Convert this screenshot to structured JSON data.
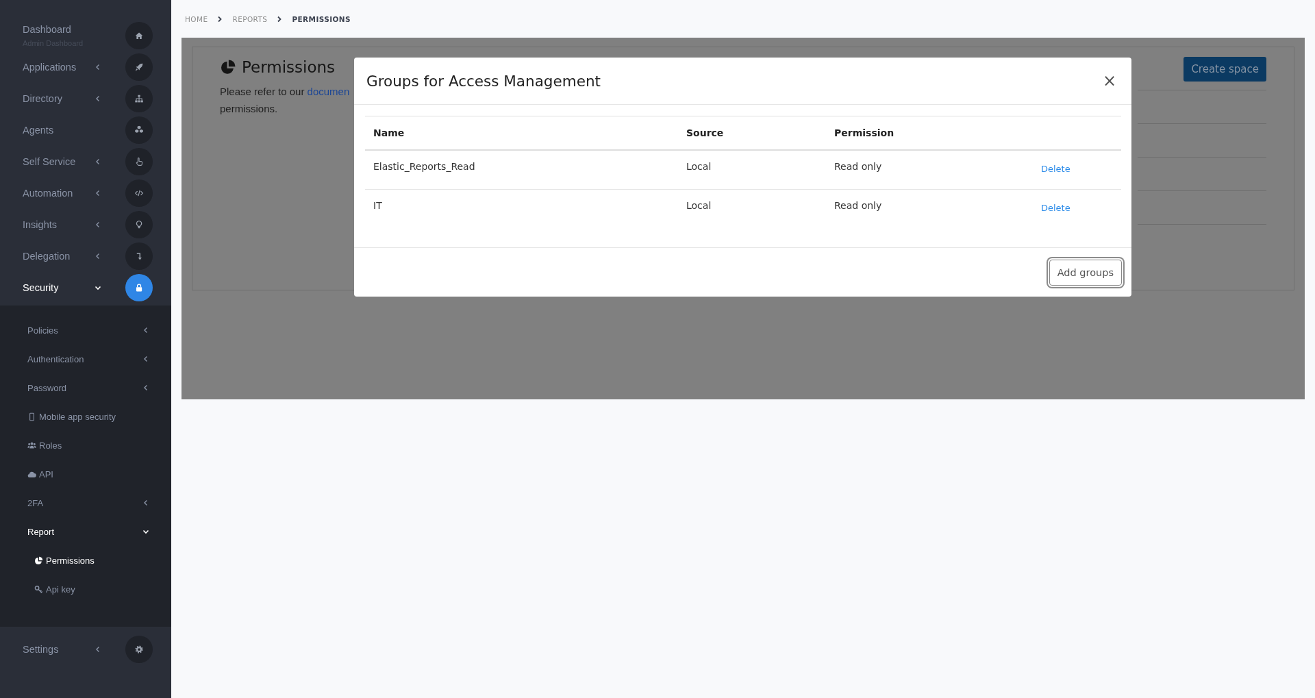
{
  "sidebar": {
    "items": [
      {
        "label": "Dashboard",
        "subtitle": "Admin Dashboard",
        "selected": false
      },
      {
        "label": "Applications",
        "selected": false,
        "expanded": false
      },
      {
        "label": "Directory",
        "selected": false,
        "expanded": false
      },
      {
        "label": "Agents",
        "selected": false
      },
      {
        "label": "Self Service",
        "selected": false,
        "expanded": false
      },
      {
        "label": "Automation",
        "selected": false,
        "expanded": false
      },
      {
        "label": "Insights",
        "selected": false,
        "expanded": false
      },
      {
        "label": "Delegation",
        "selected": false,
        "expanded": false
      },
      {
        "label": "Security",
        "selected": true,
        "expanded": true,
        "children": [
          {
            "label": "Policies",
            "selected": false,
            "expanded": false
          },
          {
            "label": "Authentication",
            "selected": false,
            "expanded": false
          },
          {
            "label": "Password",
            "selected": false,
            "expanded": false
          },
          {
            "label": "Mobile app security",
            "selected": false
          },
          {
            "label": "Roles",
            "selected": false
          },
          {
            "label": "API",
            "selected": false
          },
          {
            "label": "2FA",
            "selected": false,
            "expanded": false
          },
          {
            "label": "Report",
            "selected": true,
            "expanded": true,
            "children": [
              {
                "label": "Permissions",
                "selected": true
              },
              {
                "label": "Api key",
                "selected": false
              }
            ]
          }
        ]
      }
    ],
    "footer_item": {
      "label": "Settings",
      "selected": false,
      "expanded": false
    }
  },
  "breadcrumb": [
    {
      "label": "HOME",
      "current": false
    },
    {
      "label": "REPORTS",
      "current": false
    },
    {
      "label": "PERMISSIONS",
      "current": true
    }
  ],
  "page": {
    "title": "Permissions",
    "help_text": {
      "before": "Please refer to our",
      "link": "documen",
      "after": "permissions."
    },
    "create_button": "Create space"
  },
  "modal": {
    "title": "Groups for Access Management",
    "close": "×",
    "columns": [
      "Name",
      "Source",
      "Permission"
    ],
    "rows": [
      {
        "name": "Elastic_Reports_Read",
        "source": "Local",
        "permission": "Read only",
        "action": "Delete"
      },
      {
        "name": "IT",
        "source": "Local",
        "permission": "Read only",
        "action": "Delete"
      }
    ],
    "add_button": {
      "label": "Add groups",
      "focused": true
    }
  }
}
